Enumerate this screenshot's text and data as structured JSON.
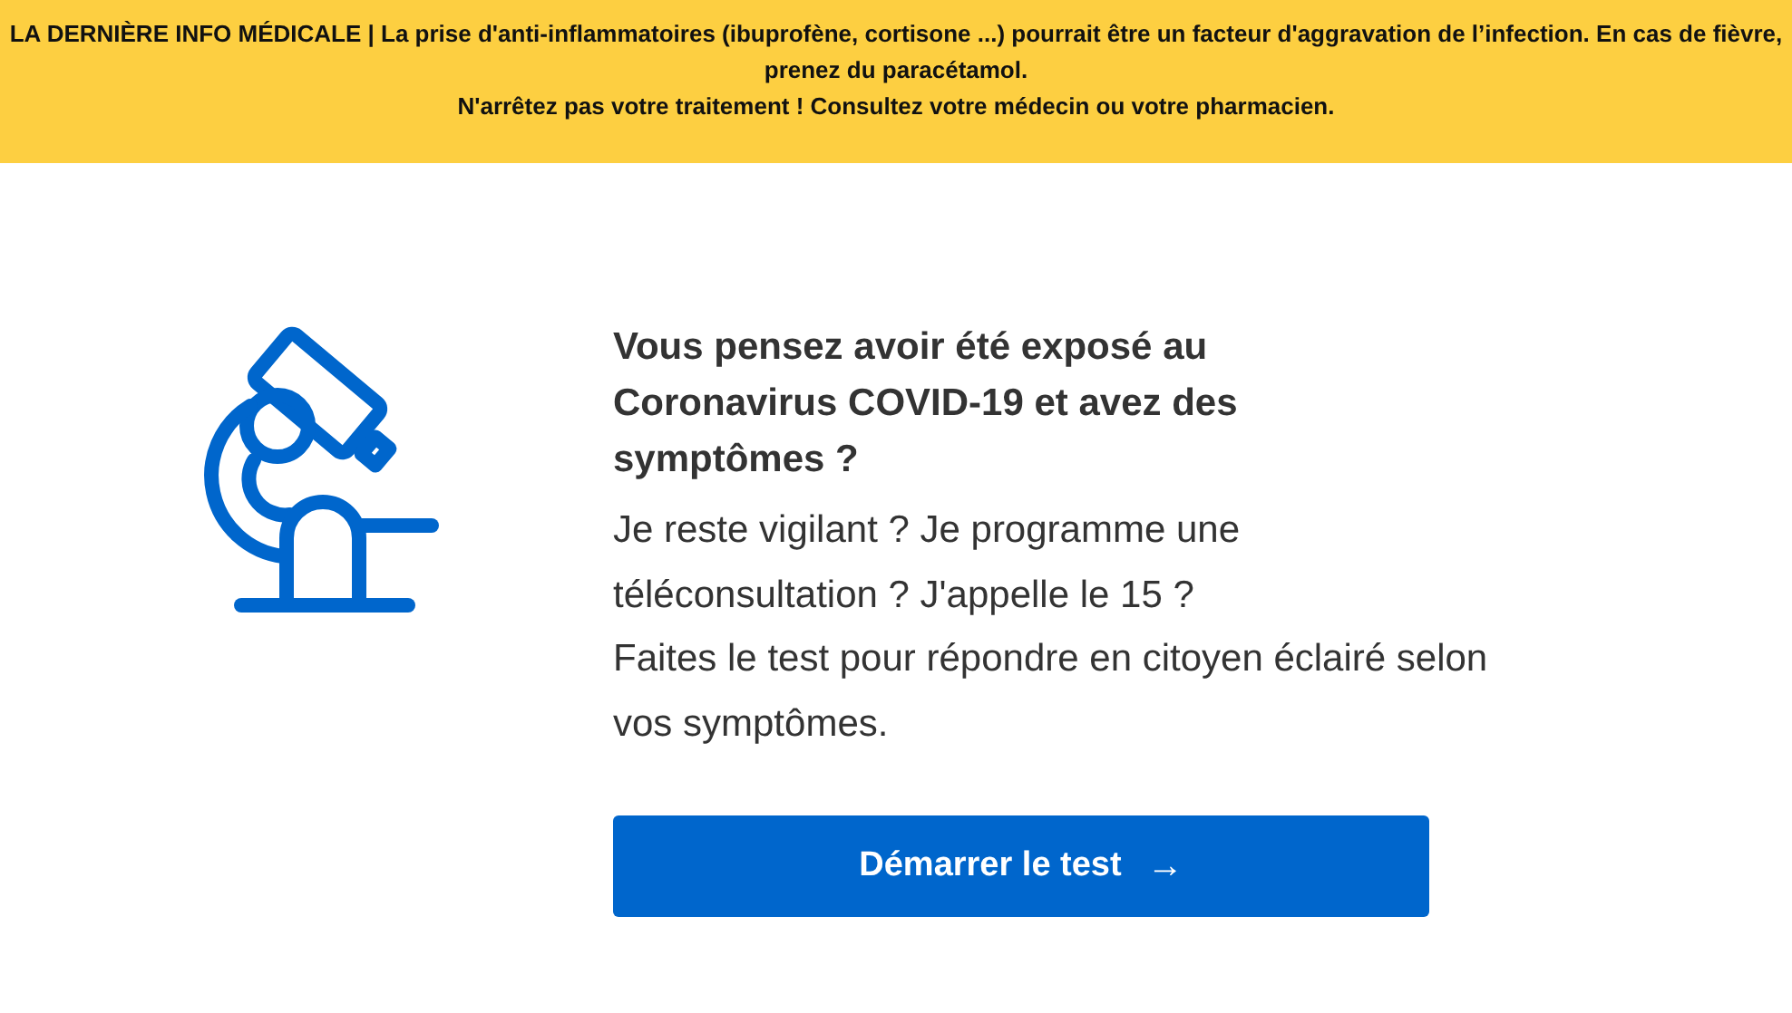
{
  "banner": {
    "paragraphs": [
      "LA DERNIÈRE INFO MÉDICALE | La prise d'anti-inflammatoires (ibuprofène, cortisone ...) pourrait être un facteur d'aggravation de l’infection. En cas de fièvre, prenez du paracétamol.",
      "N'arrêtez pas votre traitement ! Consultez votre médecin ou votre pharmacien."
    ]
  },
  "main": {
    "heading": "Vous pensez avoir été exposé au Coronavirus COVID-19 et avez des symptômes ?",
    "body": [
      "Je reste vigilant ? Je programme une téléconsultation ? J'appelle le 15 ?",
      "Faites le test pour répondre en citoyen éclairé selon vos symptômes."
    ],
    "button": {
      "label": "Démarrer le test",
      "arrow": "→"
    }
  }
}
